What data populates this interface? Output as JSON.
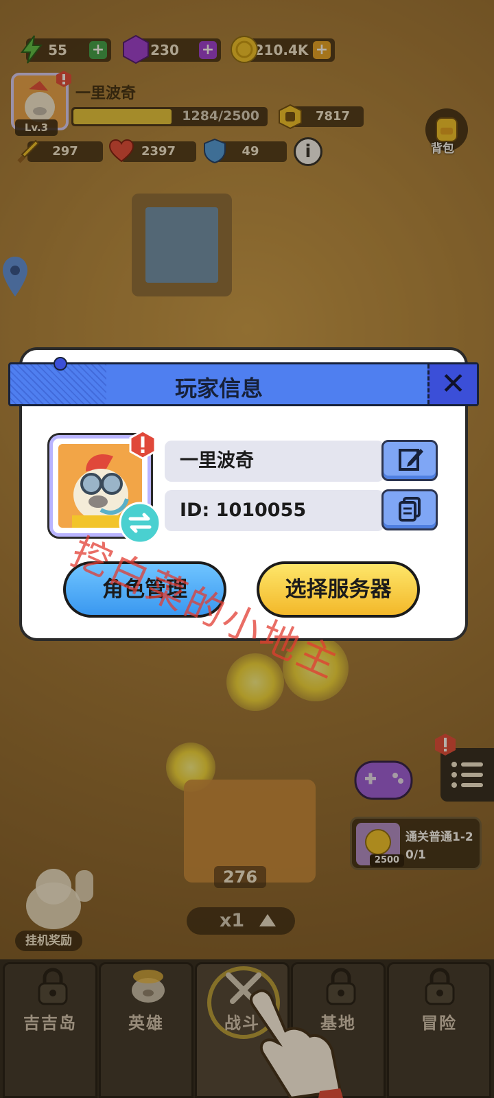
{
  "hud": {
    "energy": "55",
    "gems": "230",
    "coins": "210.4K",
    "player_name": "一里波奇",
    "level": "Lv.3",
    "xp": "1284/2500",
    "xp_fraction": 0.51,
    "power": "7817",
    "attack": "297",
    "hp": "2397",
    "defense": "49",
    "bag_label": "背包"
  },
  "dialog": {
    "title": "玩家信息",
    "name_value": "一里波奇",
    "id_value": "ID: 1010055",
    "role_button": "角色管理",
    "server_button": "选择服务器"
  },
  "watermark": "挖白菜的小地主",
  "scene": {
    "crate_count": "276",
    "speed": "x1",
    "idle_reward": "挂机奖励",
    "quest_reward": "2500",
    "quest_text": "通关普通1-2 0/1"
  },
  "nav": {
    "tabs": [
      {
        "label": "吉吉岛",
        "locked": true
      },
      {
        "label": "英雄",
        "locked": false
      },
      {
        "label": "战斗",
        "locked": false
      },
      {
        "label": "基地",
        "locked": true
      },
      {
        "label": "冒险",
        "locked": true
      }
    ]
  },
  "colors": {
    "dialog_header": "#4f7ff0",
    "role_button": "#4aa8f5",
    "server_button": "#f8d23a",
    "watermark": "#e23c32"
  },
  "icons": [
    "lightning-icon",
    "gem-icon",
    "coin-icon",
    "plus-icon",
    "fist-icon",
    "sword-icon",
    "heart-icon",
    "shield-icon",
    "info-icon",
    "backpack-icon",
    "map-pin-icon",
    "close-icon",
    "edit-icon",
    "copy-icon",
    "swap-icon",
    "alert-icon",
    "lock-icon",
    "gamepad-icon",
    "menu-list-icon",
    "pointing-hand-icon"
  ]
}
